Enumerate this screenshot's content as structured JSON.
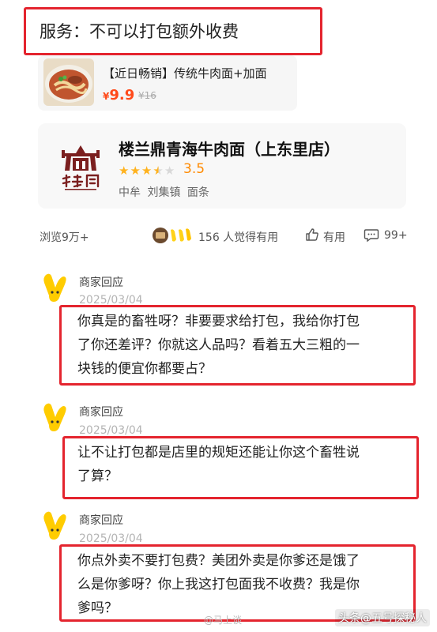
{
  "service_banner": {
    "text": "服务：不可以打包额外收费"
  },
  "product": {
    "title": "【近日畅销】传统牛肉面+加面",
    "currency": "¥",
    "price": "9.9",
    "original_price": "¥16"
  },
  "store": {
    "name": "楼兰鼎青海牛肉面（上东里店）",
    "rating": "3.5",
    "rating_value": 3.5,
    "location": "中牟 刘集镇 面条"
  },
  "stats": {
    "views": "浏览9万+",
    "helpful": "156 人觉得有用",
    "like_label": "有用",
    "comment_count": "99+"
  },
  "replies": [
    {
      "author": "商家回应",
      "date": "2025/03/04",
      "lines": [
        "你真是的畜牲呀？非要要求给打包，我给你打包",
        "了你还差评？你就这人品吗？看着五大三粗的一",
        "块钱的便宜你都要占？"
      ]
    },
    {
      "author": "商家回应",
      "date": "2025/03/04",
      "lines": [
        "让不让打包都是店里的规矩还能让你这个畜牲说",
        "了算？"
      ]
    },
    {
      "author": "商家回应",
      "date": "2025/03/04",
      "lines": [
        "你点外卖不要打包费？美团外卖是你爹还是饿了",
        "么是你爹呀？你上我这打包面我不收费？我是你",
        "爹吗？"
      ]
    }
  ],
  "watermarks": {
    "center": "@马上谈",
    "right": "头条@五号探秘人"
  },
  "colors": {
    "highlight_red": "#e4242e",
    "price_orange": "#ff4a1a",
    "star_yellow": "#ffb21e",
    "rating_orange": "#ff8a00"
  }
}
